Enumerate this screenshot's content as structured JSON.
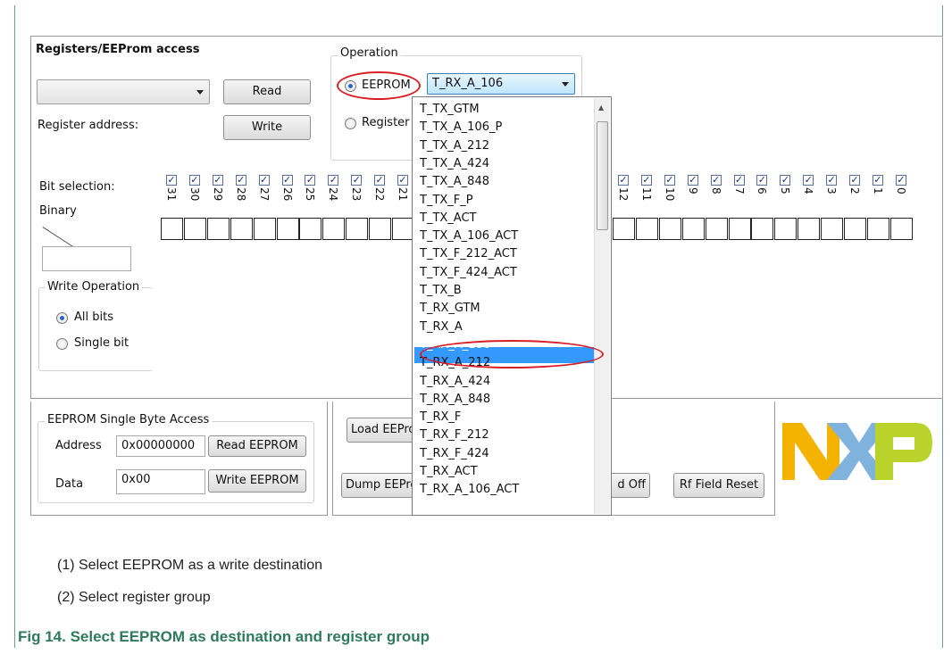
{
  "registers": {
    "title": "Registers/EEProm access",
    "read_label": "Read",
    "write_label": "Write",
    "register_address_label": "Register address:",
    "bit_selection_label": "Bit selection:",
    "binary_label": "Binary",
    "bits_left": [
      "31",
      "30",
      "29",
      "28",
      "27",
      "26",
      "25",
      "24",
      "23",
      "22",
      "21"
    ],
    "bits_right": [
      "12",
      "11",
      "10",
      "9",
      "8",
      "7",
      "6",
      "5",
      "4",
      "3",
      "2",
      "1",
      "0"
    ]
  },
  "operation": {
    "label": "Operation",
    "eeprom_label": "EEPROM",
    "register_label": "Register",
    "selected_value": "T_RX_A_106"
  },
  "write_operation": {
    "label": "Write Operation",
    "all_bits": "All bits",
    "single_bit": "Single bit"
  },
  "dropdown": {
    "items": [
      "T_TX_GTM",
      "T_TX_A_106_P",
      "T_TX_A_212",
      "T_TX_A_424",
      "T_TX_A_848",
      "T_TX_F_P",
      "T_TX_ACT",
      "T_TX_A_106_ACT",
      "T_TX_F_212_ACT",
      "T_TX_F_424_ACT",
      "T_TX_B",
      "T_RX_GTM",
      "T_RX_A",
      "T_RX_A_106",
      "T_RX_A_212",
      "T_RX_A_424",
      "T_RX_A_848",
      "T_RX_F",
      "T_RX_F_212",
      "T_RX_F_424",
      "T_RX_ACT",
      "T_RX_A_106_ACT"
    ],
    "selected_index": 13
  },
  "eeprom_single": {
    "label": "EEPROM Single Byte Access",
    "address_label": "Address",
    "address_value": "0x00000000",
    "read_eeprom": "Read EEPROM",
    "data_label": "Data",
    "data_value": "0x00",
    "write_eeprom": "Write EEPROM"
  },
  "actions": {
    "load_eeprom": "Load EEProm",
    "dump_eeprom": "Dump EEProm",
    "rf_off": "d Off",
    "rf_reset": "Rf Field Reset"
  },
  "logo": {
    "colors": [
      "#f5b301",
      "#7fb2dd",
      "#b9d32c"
    ]
  },
  "captions": {
    "item1": "(1)  Select EEPROM as a write destination",
    "item2": "(2)  Select register group",
    "figure": "Fig 14.   Select EEPROM as destination and register group"
  }
}
